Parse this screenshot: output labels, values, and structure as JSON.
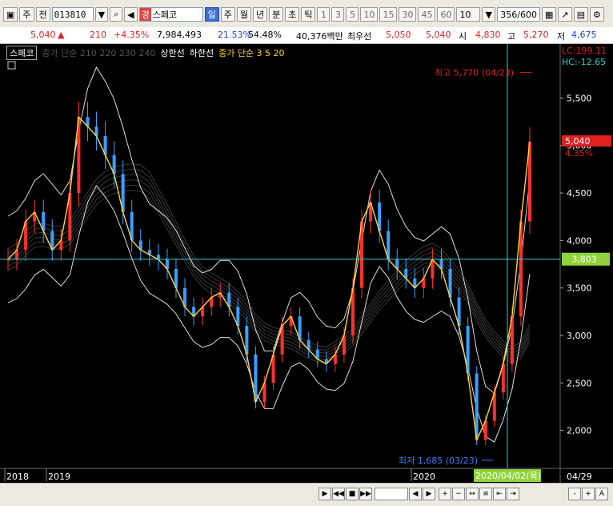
{
  "toolbar": {
    "period_buttons": [
      "주",
      "전"
    ],
    "stock_code": "013810",
    "stock_tag": "경",
    "stock_name": "스페코",
    "timeframes": [
      "일",
      "주",
      "월",
      "년",
      "분",
      "초",
      "틱"
    ],
    "selected_timeframe": "일",
    "minute_options": [
      "1",
      "3",
      "5",
      "10",
      "15",
      "30",
      "45",
      "60"
    ],
    "minute_select": "10",
    "count_value": "356",
    "count_total": "/600"
  },
  "quote": {
    "price": "5,040",
    "change_arrow": "▲",
    "change": "210",
    "change_pct": "+4.35%",
    "volume": "7,984,493",
    "turnover_ratio": "21.53%",
    "prev_ratio": "54.48%",
    "trade_value": "40,376백만",
    "priority_label": "최우선",
    "priority_ask": "5,050",
    "priority_bid": "5,040",
    "open_label": "시",
    "open": "4,830",
    "high_label": "고",
    "high": "5,270",
    "low_label": "저",
    "low": "4,675"
  },
  "legend": {
    "stock": "스페코",
    "ma_label": "종가 단순 210  220  230  240",
    "upper_line": "상한선",
    "lower_line": "하한선",
    "ma_short": "종가 단순 3  5  20"
  },
  "chart_data": {
    "type": "line",
    "title": "",
    "y_axis_ticks": [
      5500,
      5000,
      4500,
      4000,
      3500,
      3000,
      2500,
      2000
    ],
    "y_axis_labels": [
      "5,500",
      "5,000",
      "4,500",
      "4,000",
      "3,500",
      "3,000",
      "2,500",
      "2,000"
    ],
    "ylim": [
      1600,
      5900
    ],
    "x_labels": [
      "2018",
      "2019",
      "2020",
      "04/29"
    ],
    "current_price_label": "5,040",
    "current_change_label": "4.35%",
    "crosshair_price_label": "3,803",
    "crosshair_price": 3803,
    "crosshair_date_label": "2020/04/02(목)",
    "high_marker": {
      "label": "최고 5,770 (04/23)",
      "value": 5770
    },
    "low_marker": {
      "label": "최저 1,685 (03/23)",
      "value": 1685
    },
    "lc_label": "LC:199.11",
    "hc_label": "HC:-12.65",
    "series": [
      {
        "name": "close",
        "values": [
          3800,
          3900,
          4200,
          4300,
          4100,
          3900,
          4000,
          4500,
          5300,
          5200,
          5100,
          4900,
          4700,
          4300,
          4000,
          3900,
          3850,
          3800,
          3700,
          3500,
          3300,
          3200,
          3300,
          3400,
          3450,
          3300,
          3100,
          2800,
          2300,
          2500,
          2800,
          3100,
          3200,
          2950,
          2850,
          2750,
          2700,
          2800,
          3000,
          3500,
          4200,
          4400,
          4100,
          3800,
          3700,
          3600,
          3500,
          3600,
          3800,
          3700,
          3400,
          3100,
          2600,
          1900,
          2100,
          2400,
          2700,
          3200,
          4200,
          5040
        ]
      }
    ]
  },
  "bottom": {
    "zoom_controls": [
      "-",
      "+",
      "A"
    ]
  }
}
